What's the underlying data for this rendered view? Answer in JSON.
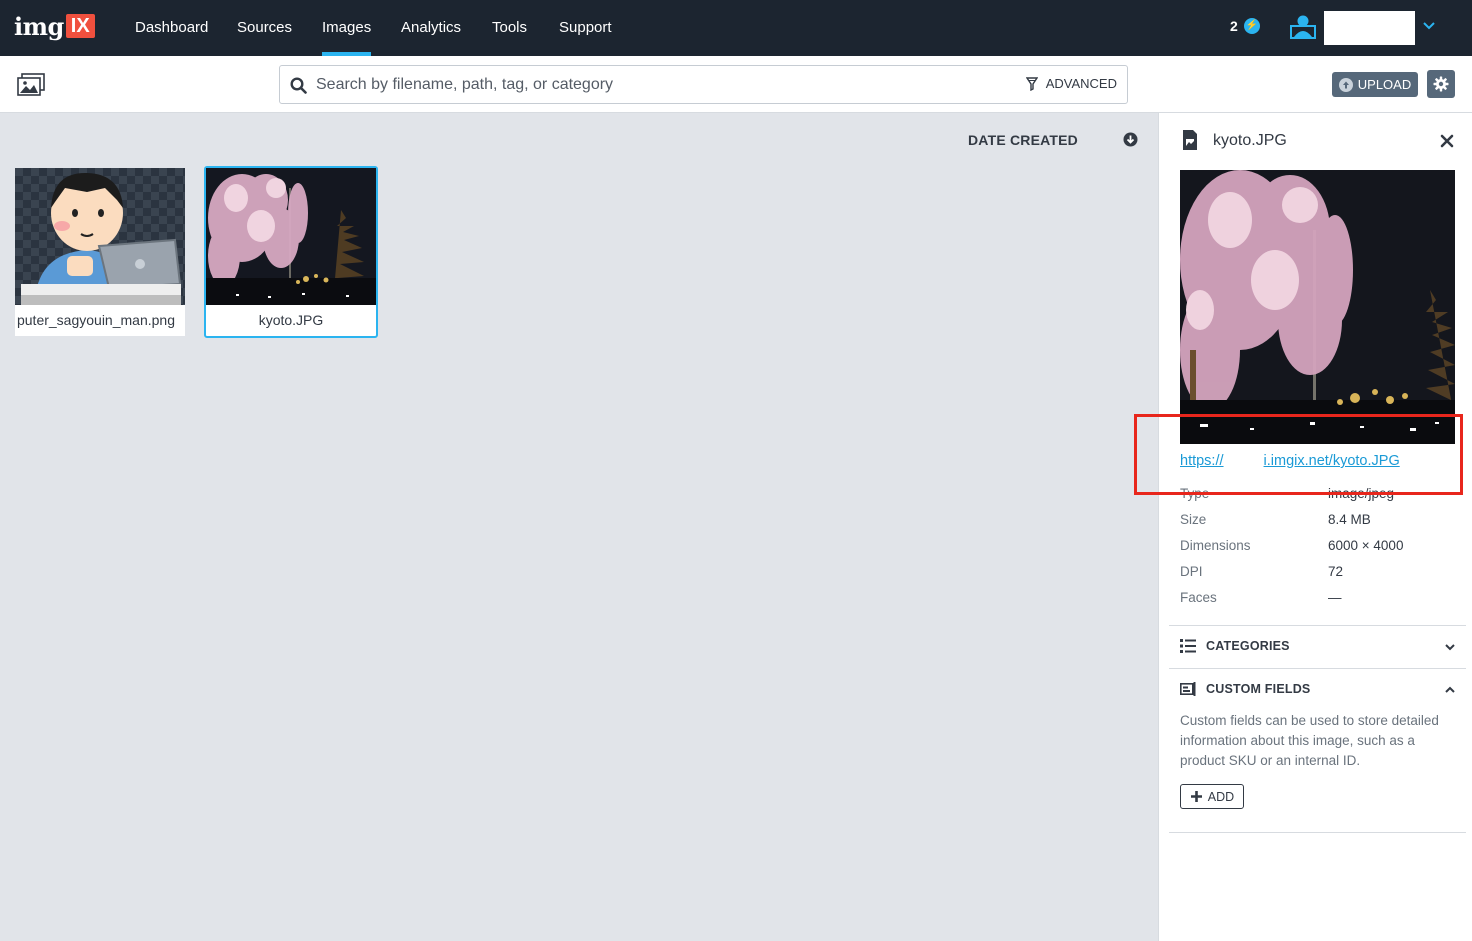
{
  "nav": {
    "logo_text": "img",
    "logo_badge": "IX",
    "items": [
      {
        "label": "Dashboard",
        "active": false
      },
      {
        "label": "Sources",
        "active": false
      },
      {
        "label": "Images",
        "active": true
      },
      {
        "label": "Analytics",
        "active": false
      },
      {
        "label": "Tools",
        "active": false
      },
      {
        "label": "Support",
        "active": false
      }
    ],
    "credits": "2",
    "icons": {
      "credits": "bolt-icon",
      "user": "user-icon",
      "account_menu": "chevron-down-icon"
    }
  },
  "toolbar": {
    "search_placeholder": "Search by filename, path, tag, or category",
    "advanced_label": "ADVANCED",
    "upload_label": "UPLOAD",
    "icons": {
      "gallery": "image-gallery-icon",
      "search": "search-icon",
      "filter": "filter-icon",
      "upload": "upload-icon",
      "settings": "gear-icon"
    }
  },
  "gallery": {
    "sort_label": "DATE CREATED",
    "sort_icon": "sort-down-icon",
    "images": [
      {
        "filename": "puter_sagyouin_man.png",
        "selected": false
      },
      {
        "filename": "kyoto.JPG",
        "selected": true
      }
    ]
  },
  "details": {
    "title": "kyoto.JPG",
    "url_prefix": "https://",
    "url_suffix": "i.imgix.net/kyoto.JPG",
    "metadata": [
      {
        "label": "Type",
        "value": "image/jpeg"
      },
      {
        "label": "Size",
        "value": "8.4 MB"
      },
      {
        "label": "Dimensions",
        "value": "6000 × 4000"
      },
      {
        "label": "DPI",
        "value": "72"
      },
      {
        "label": "Faces",
        "value": "—"
      }
    ],
    "categories_label": "CATEGORIES",
    "custom_fields_label": "CUSTOM FIELDS",
    "custom_fields_help": "Custom fields can be used to store detailed information about this image, such as a product SKU or an internal ID.",
    "add_label": "ADD",
    "icons": {
      "file": "file-image-icon",
      "close": "close-icon",
      "categories": "list-icon",
      "custom_fields": "custom-fields-icon",
      "add": "plus-icon"
    }
  },
  "colors": {
    "nav_bg": "#1c2530",
    "accent": "#2bb4f0",
    "logo_badge": "#f0503e",
    "highlight": "#e8261c",
    "button": "#56687a"
  }
}
